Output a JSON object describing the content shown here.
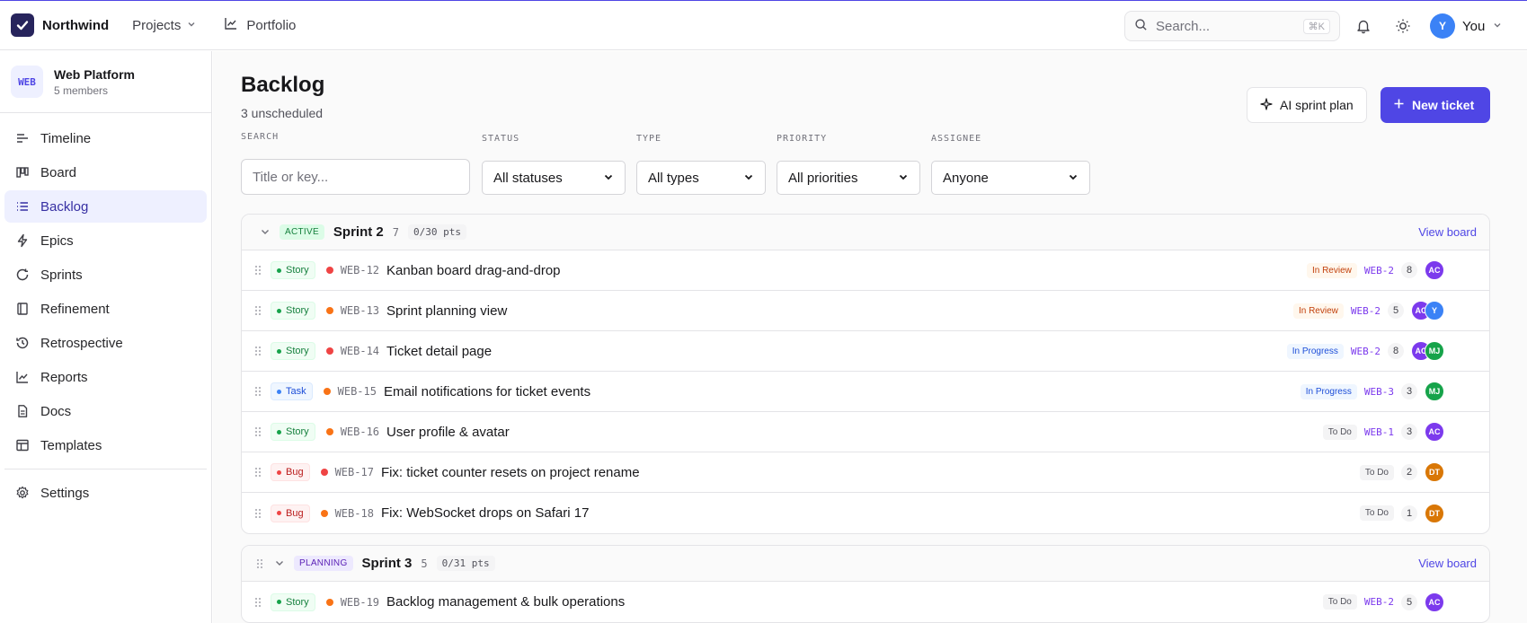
{
  "app": {
    "name": "Northwind"
  },
  "topnav": {
    "projects_label": "Projects",
    "portfolio_label": "Portfolio",
    "search_placeholder": "Search...",
    "search_shortcut": "⌘K",
    "user_initial": "Y",
    "user_label": "You"
  },
  "workspace": {
    "badge": "WEB",
    "name": "Web Platform",
    "members": "5 members"
  },
  "sidebar": {
    "items": [
      {
        "label": "Timeline",
        "icon": "timeline-icon",
        "active": false
      },
      {
        "label": "Board",
        "icon": "board-icon",
        "active": false
      },
      {
        "label": "Backlog",
        "icon": "list-icon",
        "active": true
      },
      {
        "label": "Epics",
        "icon": "bolt-icon",
        "active": false
      },
      {
        "label": "Sprints",
        "icon": "cycle-icon",
        "active": false
      },
      {
        "label": "Refinement",
        "icon": "layers-icon",
        "active": false
      },
      {
        "label": "Retrospective",
        "icon": "history-icon",
        "active": false
      },
      {
        "label": "Reports",
        "icon": "chart-icon",
        "active": false
      },
      {
        "label": "Docs",
        "icon": "doc-icon",
        "active": false
      },
      {
        "label": "Templates",
        "icon": "template-icon",
        "active": false
      }
    ],
    "settings_label": "Settings"
  },
  "page": {
    "title": "Backlog",
    "subtitle": "3 unscheduled",
    "ai_button": "AI sprint plan",
    "new_button": "New ticket"
  },
  "filters": {
    "search_label": "SEARCH",
    "search_placeholder": "Title or key...",
    "status_label": "STATUS",
    "status_value": "All statuses",
    "type_label": "TYPE",
    "type_value": "All types",
    "priority_label": "PRIORITY",
    "priority_value": "All priorities",
    "assignee_label": "ASSIGNEE",
    "assignee_value": "Anyone"
  },
  "sprints": [
    {
      "state": "ACTIVE",
      "name": "Sprint 2",
      "count": "7",
      "points": "0/30 pts",
      "view_board": "View board",
      "tickets": [
        {
          "type": "Story",
          "priority_color": "#ef4444",
          "key": "WEB-12",
          "title": "Kanban board drag-and-drop",
          "status": "In Review",
          "epic": "WEB-2",
          "points": "8",
          "assignees": [
            "AC"
          ]
        },
        {
          "type": "Story",
          "priority_color": "#f97316",
          "key": "WEB-13",
          "title": "Sprint planning view",
          "status": "In Review",
          "epic": "WEB-2",
          "points": "5",
          "assignees": [
            "AC",
            "Y"
          ]
        },
        {
          "type": "Story",
          "priority_color": "#ef4444",
          "key": "WEB-14",
          "title": "Ticket detail page",
          "status": "In Progress",
          "epic": "WEB-2",
          "points": "8",
          "assignees": [
            "AC",
            "MJ"
          ]
        },
        {
          "type": "Task",
          "priority_color": "#f97316",
          "key": "WEB-15",
          "title": "Email notifications for ticket events",
          "status": "In Progress",
          "epic": "WEB-3",
          "points": "3",
          "assignees": [
            "MJ"
          ]
        },
        {
          "type": "Story",
          "priority_color": "#f97316",
          "key": "WEB-16",
          "title": "User profile & avatar",
          "status": "To Do",
          "epic": "WEB-1",
          "points": "3",
          "assignees": [
            "AC"
          ]
        },
        {
          "type": "Bug",
          "priority_color": "#ef4444",
          "key": "WEB-17",
          "title": "Fix: ticket counter resets on project rename",
          "status": "To Do",
          "epic": "",
          "points": "2",
          "assignees": [
            "DT"
          ]
        },
        {
          "type": "Bug",
          "priority_color": "#f97316",
          "key": "WEB-18",
          "title": "Fix: WebSocket drops on Safari 17",
          "status": "To Do",
          "epic": "",
          "points": "1",
          "assignees": [
            "DT"
          ]
        }
      ]
    },
    {
      "state": "PLANNING",
      "name": "Sprint 3",
      "count": "5",
      "points": "0/31 pts",
      "view_board": "View board",
      "tickets": [
        {
          "type": "Story",
          "priority_color": "#f97316",
          "key": "WEB-19",
          "title": "Backlog management & bulk operations",
          "status": "To Do",
          "epic": "WEB-2",
          "points": "5",
          "assignees": [
            "AC"
          ]
        }
      ]
    }
  ],
  "colors": {
    "accent": "#4f46e5",
    "avatar_AC": "#7c3aed",
    "avatar_Y": "#3b82f6",
    "avatar_MJ": "#16a34a",
    "avatar_DT": "#d97706"
  }
}
